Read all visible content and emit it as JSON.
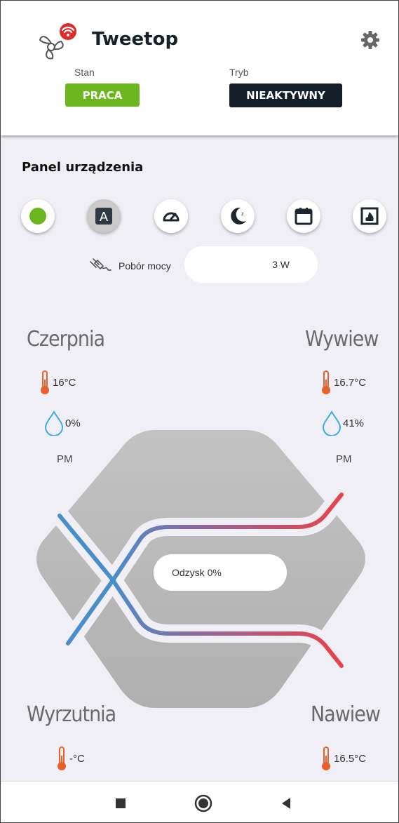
{
  "header": {
    "app_title": "Tweetop",
    "state_label": "Stan",
    "state_value": "PRACA",
    "mode_label": "Tryb",
    "mode_value": "NIEAKTYWNY",
    "state_color": "#6cb71f",
    "mode_color": "#142029"
  },
  "panel": {
    "title": "Panel urządzenia",
    "modes": [
      {
        "icon": "power-status-icon"
      },
      {
        "icon": "auto-mode-icon",
        "glyph": "A"
      },
      {
        "icon": "speedometer-icon"
      },
      {
        "icon": "night-mode-icon"
      },
      {
        "icon": "calendar-icon"
      },
      {
        "icon": "fireplace-icon"
      }
    ],
    "power_label": "Pobór mocy",
    "power_value": "3 W"
  },
  "intake": {
    "title": "Czerpnia",
    "temperature": "16°C",
    "humidity": "0%",
    "pm": "PM"
  },
  "extract": {
    "title": "Wywiew",
    "temperature": "16.7°C",
    "humidity": "41%",
    "pm": "PM"
  },
  "exhaust": {
    "title": "Wyrzutnia",
    "temperature": "-°C"
  },
  "supply": {
    "title": "Nawiew",
    "temperature": "16.5°C"
  },
  "recovery": {
    "label": "Odzysk 0%"
  },
  "colors": {
    "cold": "#4a8ec9",
    "hot": "#e8424a",
    "thermo": "#e8602a",
    "drop": "#3aaee0"
  }
}
